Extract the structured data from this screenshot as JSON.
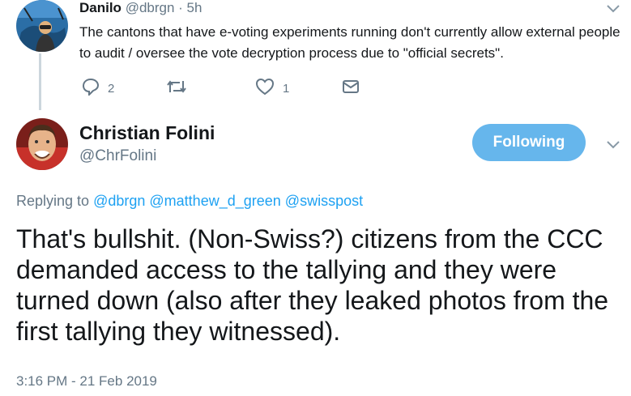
{
  "reply_tweet": {
    "author_name": "Danilo",
    "author_handle": "@dbrgn",
    "timestamp": "· 5h",
    "text": "The cantons that have e-voting experiments running don't currently allow external people to audit / oversee the vote decryption process due to \"official secrets\".",
    "reply_count": "2",
    "retweet_count": "",
    "like_count": "1"
  },
  "main_tweet": {
    "author_name": "Christian Folini",
    "author_handle": "@ChrFolini",
    "follow_label": "Following",
    "replying_label": "Replying to",
    "replying_handles": [
      "@dbrgn",
      "@matthew_d_green",
      "@swisspost"
    ],
    "text": "That's bullshit. (Non-Swiss?) citizens from the CCC demanded access to the tallying and they were turned down (also after they leaked photos from the first tallying they witnessed).",
    "timestamp": "3:16 PM - 21 Feb 2019"
  },
  "colors": {
    "accent": "#1da1f2",
    "follow_button": "#66b6ec",
    "muted": "#657786"
  },
  "icons": [
    "reply-icon",
    "retweet-icon",
    "like-icon",
    "message-icon",
    "chevron-down-icon"
  ]
}
